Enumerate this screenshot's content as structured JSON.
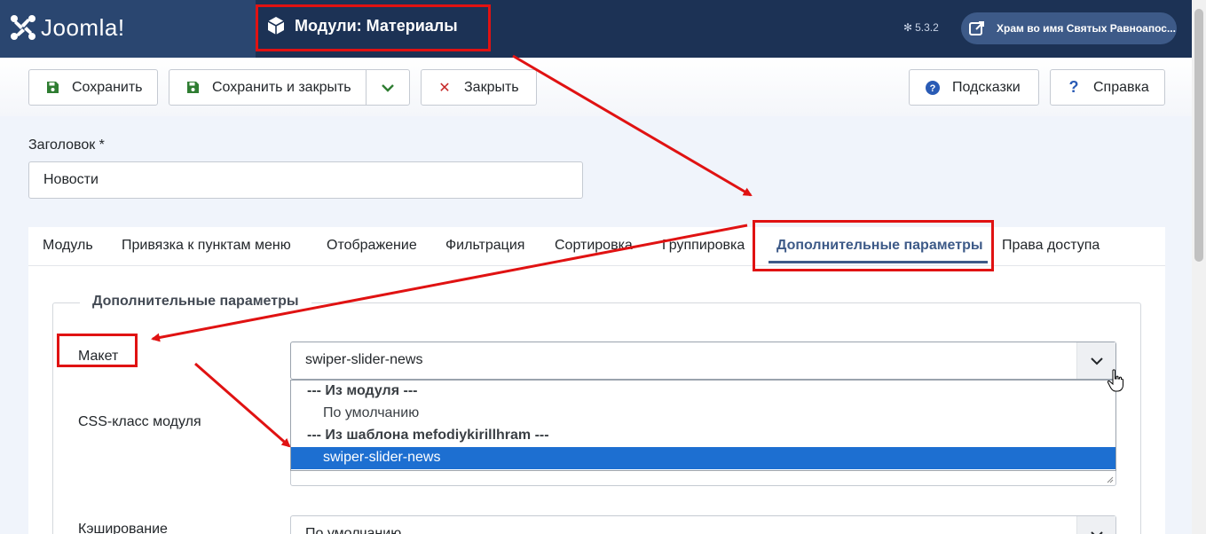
{
  "header": {
    "logo_text": "Joomla!",
    "page_title": "Модули: Материалы",
    "version": "5.3.2",
    "site_name": "Храм во имя Святых Равноапос..."
  },
  "toolbar": {
    "save_label": "Сохранить",
    "save_close_label": "Сохранить и закрыть",
    "close_label": "Закрыть",
    "tips_label": "Подсказки",
    "help_label": "Справка"
  },
  "form": {
    "title_label": "Заголовок *",
    "title_value": "Новости"
  },
  "tabs": [
    {
      "label": "Модуль"
    },
    {
      "label": "Привязка к пунктам меню"
    },
    {
      "label": "Отображение"
    },
    {
      "label": "Фильтрация"
    },
    {
      "label": "Сортировка"
    },
    {
      "label": "Группировка"
    },
    {
      "label": "Дополнительные параметры"
    },
    {
      "label": "Права доступа"
    }
  ],
  "active_tab": "Дополнительные параметры",
  "panel": {
    "legend": "Дополнительные параметры",
    "layout_label": "Макет",
    "layout_value": "swiper-slider-news",
    "css_label": "CSS-класс модуля",
    "cache_label": "Кэширование",
    "cache_value": "По умолчанию",
    "dropdown": {
      "group1": "--- Из модуля ---",
      "opt1": "По умолчанию",
      "group2": "--- Из шаблона mefodiykirillhram ---",
      "opt2": "swiper-slider-news"
    }
  },
  "colors": {
    "header_bg": "#1c3255",
    "accent": "#3d5a88",
    "annotation_red": "#e01212",
    "selected_option": "#1d6fd1"
  }
}
